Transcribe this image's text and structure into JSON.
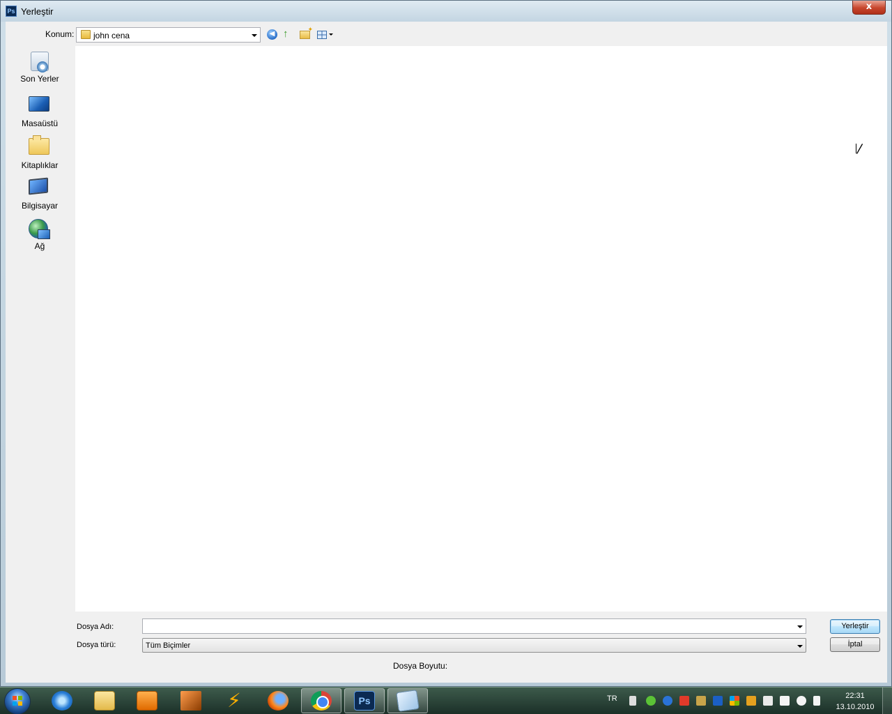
{
  "window": {
    "title": "Yerleştir",
    "app_icon": "Ps",
    "close_label": "x"
  },
  "toolbar": {
    "location_label": "Konum:",
    "location_value": "john cena",
    "icons": [
      "back-icon",
      "up-folder-icon",
      "new-folder-icon",
      "view-menu-icon"
    ]
  },
  "places": [
    {
      "label": "Son Yerler",
      "icon": "recent-places-icon"
    },
    {
      "label": "Masaüstü",
      "icon": "desktop-icon"
    },
    {
      "label": "Kitaplıklar",
      "icon": "libraries-icon"
    },
    {
      "label": "Bilgisayar",
      "icon": "computer-icon"
    },
    {
      "label": "Ağ",
      "icon": "network-icon"
    }
  ],
  "form": {
    "file_name_label": "Dosya Adı:",
    "file_name_value": "",
    "file_type_label": "Dosya türü:",
    "file_type_value": "Tüm Biçimler",
    "file_size_label": "Dosya Boyutu:"
  },
  "buttons": {
    "place": "Yerleştir",
    "cancel": "İptal"
  },
  "taskbar": {
    "apps": [
      "internet-explorer-icon",
      "windows-explorer-icon",
      "media-player-icon",
      "video-editor-icon",
      "winamp-icon",
      "firefox-icon",
      "chrome-icon",
      "photoshop-icon",
      "notepad-icon"
    ],
    "photoshop_label": "Ps",
    "language": "TR",
    "time": "22:31",
    "date": "13.10.2010"
  },
  "colors": {
    "accent": "#3c7fb1",
    "close_button": "#c7462c",
    "taskbar": "#2c4a3c"
  }
}
